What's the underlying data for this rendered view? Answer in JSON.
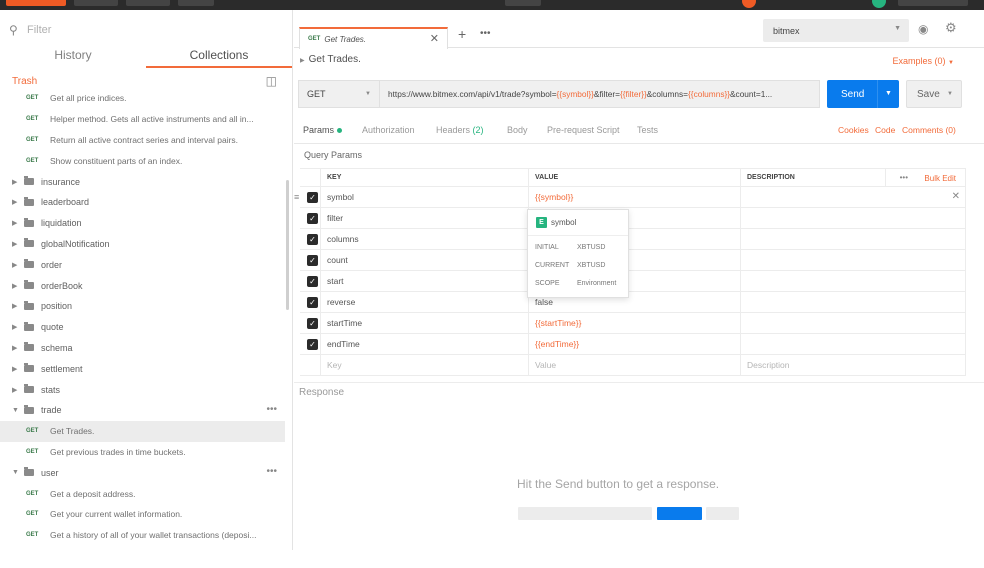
{
  "sidebar": {
    "filter_placeholder": "Filter",
    "tabs": [
      "History",
      "Collections"
    ],
    "trash_label": "Trash",
    "tree": [
      {
        "kind": "req",
        "method": "GET",
        "label": "Get all price indices."
      },
      {
        "kind": "req",
        "method": "GET",
        "label": "Helper method. Gets all active instruments and all in..."
      },
      {
        "kind": "req",
        "method": "GET",
        "label": "Return all active contract series and interval pairs."
      },
      {
        "kind": "req",
        "method": "GET",
        "label": "Show constituent parts of an index."
      },
      {
        "kind": "folder",
        "label": "insurance",
        "open": false
      },
      {
        "kind": "folder",
        "label": "leaderboard",
        "open": false
      },
      {
        "kind": "folder",
        "label": "liquidation",
        "open": false
      },
      {
        "kind": "folder",
        "label": "globalNotification",
        "open": false
      },
      {
        "kind": "folder",
        "label": "order",
        "open": false
      },
      {
        "kind": "folder",
        "label": "orderBook",
        "open": false
      },
      {
        "kind": "folder",
        "label": "position",
        "open": false
      },
      {
        "kind": "folder",
        "label": "quote",
        "open": false
      },
      {
        "kind": "folder",
        "label": "schema",
        "open": false
      },
      {
        "kind": "folder",
        "label": "settlement",
        "open": false
      },
      {
        "kind": "folder",
        "label": "stats",
        "open": false
      },
      {
        "kind": "folder",
        "label": "trade",
        "open": true,
        "more": true
      },
      {
        "kind": "req",
        "method": "GET",
        "label": "Get Trades.",
        "selected": true
      },
      {
        "kind": "req",
        "method": "GET",
        "label": "Get previous trades in time buckets."
      },
      {
        "kind": "folder",
        "label": "user",
        "open": true,
        "more": true
      },
      {
        "kind": "req",
        "method": "GET",
        "label": "Get a deposit address."
      },
      {
        "kind": "req",
        "method": "GET",
        "label": "Get your current wallet information."
      },
      {
        "kind": "req",
        "method": "GET",
        "label": "Get a history of all of your wallet transactions (deposi..."
      }
    ]
  },
  "tab": {
    "method": "GET",
    "title": "Get Trades."
  },
  "environment": {
    "selected": "bitmex"
  },
  "request": {
    "name": "Get Trades.",
    "examples": "Examples (0)",
    "method": "GET",
    "url_parts": [
      {
        "t": "https://www.bitmex.com/api/v1/trade?symbol=",
        "v": false
      },
      {
        "t": "{{symbol}}",
        "v": true
      },
      {
        "t": "&filter=",
        "v": false
      },
      {
        "t": "{{filter}}",
        "v": true
      },
      {
        "t": "&columns=",
        "v": false
      },
      {
        "t": "{{columns}}",
        "v": true
      },
      {
        "t": "&count=1...",
        "v": false
      }
    ],
    "send_label": "Send",
    "save_label": "Save"
  },
  "subtabs": {
    "params": "Params",
    "authorization": "Authorization",
    "headers": "Headers",
    "headers_count": "(2)",
    "body": "Body",
    "prerequest": "Pre-request Script",
    "tests": "Tests",
    "cookies": "Cookies",
    "code": "Code",
    "comments": "Comments (0)"
  },
  "params": {
    "section_label": "Query Params",
    "headers": {
      "key": "KEY",
      "value": "VALUE",
      "description": "DESCRIPTION",
      "bulk_edit": "Bulk Edit"
    },
    "rows": [
      {
        "key": "symbol",
        "value": "{{symbol}}",
        "var": true
      },
      {
        "key": "filter",
        "value": "",
        "var": false
      },
      {
        "key": "columns",
        "value": "",
        "var": false
      },
      {
        "key": "count",
        "value": "",
        "var": false
      },
      {
        "key": "start",
        "value": "",
        "var": false
      },
      {
        "key": "reverse",
        "value": "false",
        "var": false
      },
      {
        "key": "startTime",
        "value": "{{startTime}}",
        "var": true
      },
      {
        "key": "endTime",
        "value": "{{endTime}}",
        "var": true
      }
    ],
    "new_row": {
      "key": "Key",
      "value": "Value",
      "description": "Description"
    }
  },
  "autocomplete": {
    "badge": "E",
    "name": "symbol",
    "initial_label": "INITIAL",
    "initial": "XBTUSD",
    "current_label": "CURRENT",
    "current": "XBTUSD",
    "scope_label": "SCOPE",
    "scope": "Environment"
  },
  "response": {
    "label": "Response",
    "hint": "Hit the Send button to get a response."
  },
  "colors": {
    "accent": "#f26b3a",
    "send": "#097bed",
    "env_badge": "#26b47f"
  }
}
